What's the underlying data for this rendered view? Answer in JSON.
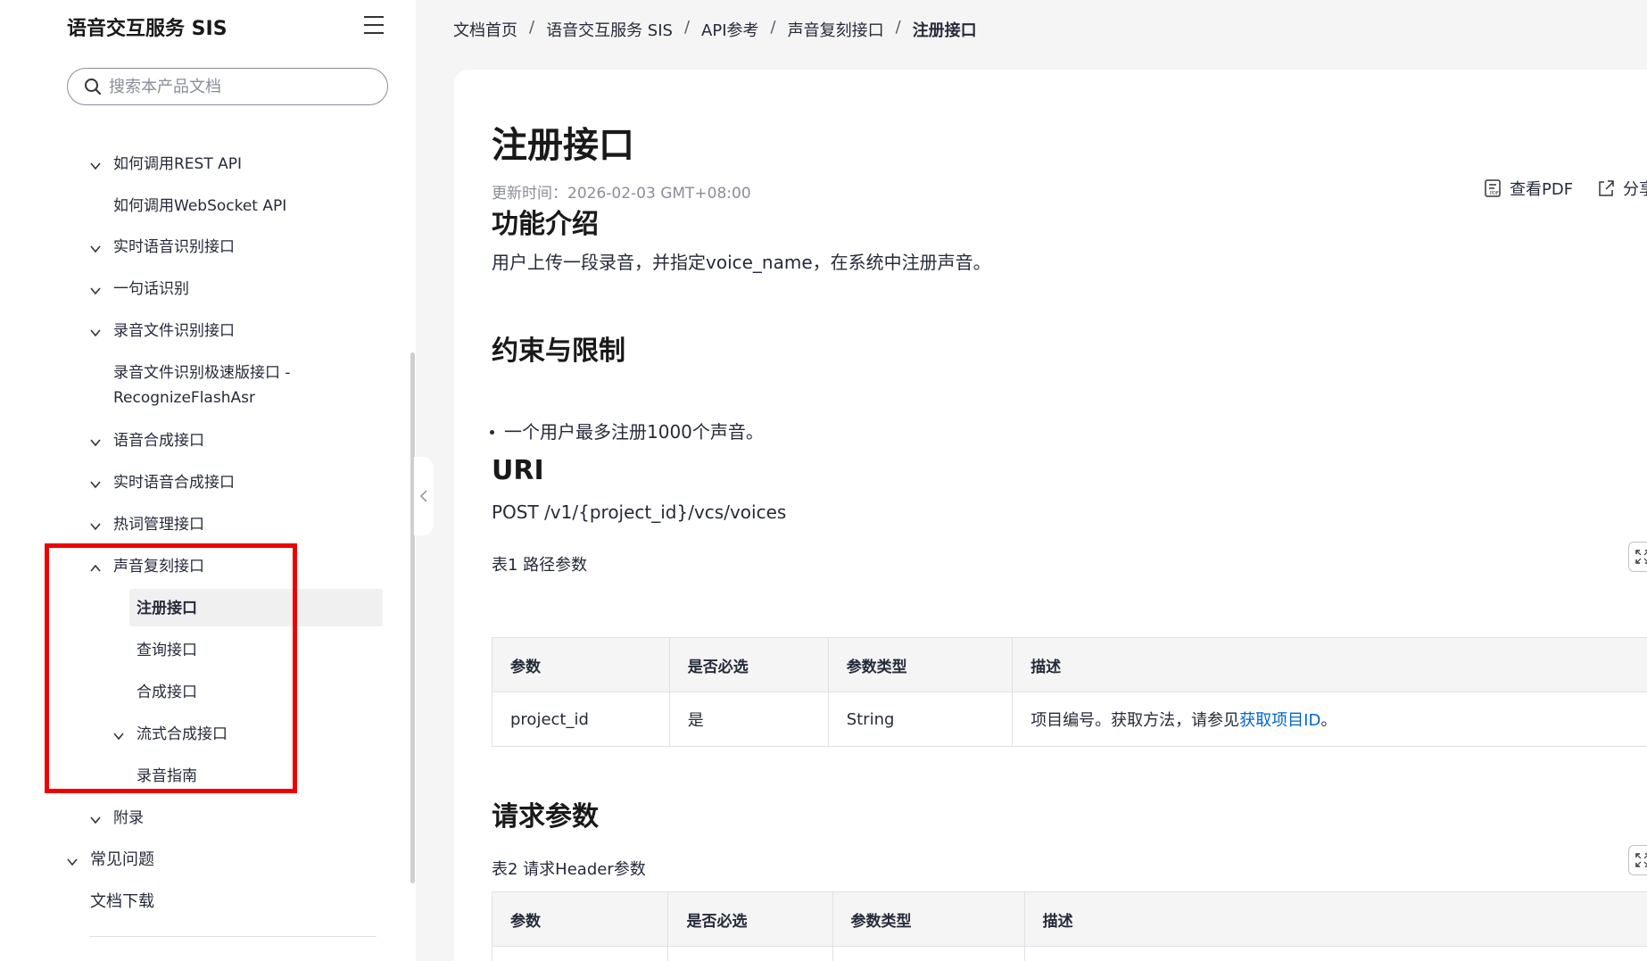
{
  "sidebar": {
    "product_title": "语音交互服务 SIS",
    "search_placeholder": "搜索本产品文档",
    "items": [
      {
        "label": "如何调用REST API",
        "chevron": "down"
      },
      {
        "label": "如何调用WebSocket API",
        "chevron": "none"
      },
      {
        "label": "实时语音识别接口",
        "chevron": "down"
      },
      {
        "label": "一句话识别",
        "chevron": "down"
      },
      {
        "label": "录音文件识别接口",
        "chevron": "down"
      },
      {
        "label": "录音文件识别极速版接口 -",
        "chevron": "none"
      },
      {
        "label": "RecognizeFlashAsr",
        "chevron": "none"
      },
      {
        "label": "语音合成接口",
        "chevron": "down"
      },
      {
        "label": "实时语音合成接口",
        "chevron": "down"
      },
      {
        "label": "热词管理接口",
        "chevron": "down"
      },
      {
        "label": "声音复刻接口",
        "chevron": "up"
      },
      {
        "label": "注册接口",
        "chevron": "none",
        "active": true
      },
      {
        "label": "查询接口",
        "chevron": "none"
      },
      {
        "label": "合成接口",
        "chevron": "none"
      },
      {
        "label": "流式合成接口",
        "chevron": "down"
      },
      {
        "label": "录音指南",
        "chevron": "none"
      },
      {
        "label": "附录",
        "chevron": "down"
      },
      {
        "label": "常见问题",
        "chevron": "down"
      },
      {
        "label": "文档下载",
        "chevron": "none"
      }
    ]
  },
  "breadcrumb": [
    "文档首页",
    "语音交互服务 SIS",
    "API参考",
    "声音复刻接口",
    "注册接口"
  ],
  "breadcrumb_sep": "/",
  "main": {
    "title": "注册接口",
    "update_time": "更新时间：2026-02-03 GMT+08:00",
    "view_pdf": "查看PDF",
    "share": "分享",
    "sections": {
      "intro_heading": "功能介绍",
      "intro_text": "用户上传一段录音，并指定voice_name，在系统中注册声音。",
      "limits_heading": "约束与限制",
      "limits_bullet": "一个用户最多注册1000个声音。",
      "uri_heading": "URI",
      "uri_text": "POST /v1/{project_id}/vcs/voices",
      "request_heading": "请求参数"
    },
    "table1": {
      "caption": "表1 路径参数",
      "headers": [
        "参数",
        "是否必选",
        "参数类型",
        "描述"
      ],
      "row": {
        "param": "project_id",
        "required": "是",
        "type": "String",
        "desc_prefix": "项目编号。获取方法，请参见",
        "desc_link": "获取项目ID",
        "desc_suffix": "。"
      }
    },
    "table2": {
      "caption": "表2 请求Header参数",
      "headers": [
        "参数",
        "是否必选",
        "参数类型",
        "描述"
      ]
    }
  },
  "colors": {
    "link": "#0066cc",
    "highlight_box": "#ee0000",
    "active_bg": "#f0f0f0"
  }
}
